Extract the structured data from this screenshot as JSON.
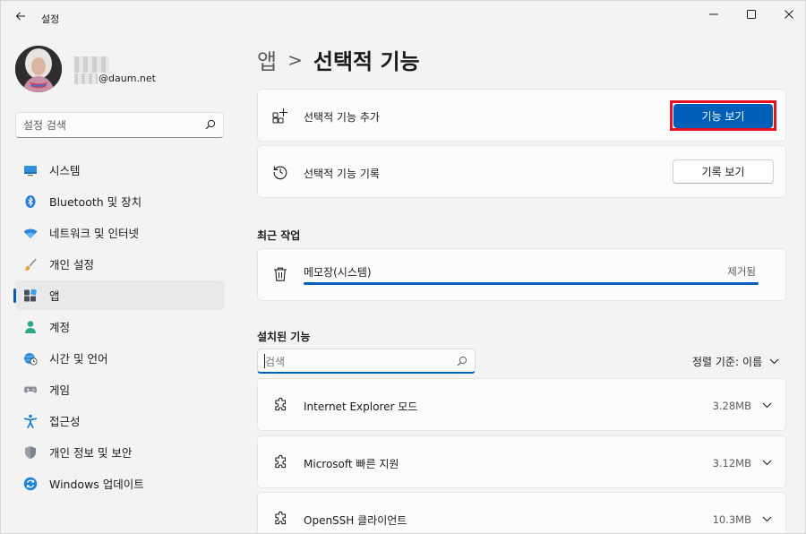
{
  "window": {
    "title": "설정"
  },
  "user": {
    "email_suffix": "@daum.net"
  },
  "sidebar": {
    "search_placeholder": "설정 검색",
    "items": [
      {
        "label": "시스템",
        "icon": "monitor-icon"
      },
      {
        "label": "Bluetooth 및 장치",
        "icon": "bluetooth-icon"
      },
      {
        "label": "네트워크 및 인터넷",
        "icon": "wifi-icon"
      },
      {
        "label": "개인 설정",
        "icon": "paintbrush-icon"
      },
      {
        "label": "앱",
        "icon": "apps-icon",
        "active": true
      },
      {
        "label": "계정",
        "icon": "person-icon"
      },
      {
        "label": "시간 및 언어",
        "icon": "globe-clock-icon"
      },
      {
        "label": "게임",
        "icon": "gamepad-icon"
      },
      {
        "label": "접근성",
        "icon": "accessibility-icon"
      },
      {
        "label": "개인 정보 및 보안",
        "icon": "shield-icon"
      },
      {
        "label": "Windows 업데이트",
        "icon": "update-icon"
      }
    ]
  },
  "breadcrumb": {
    "parent": "앱",
    "separator": ">",
    "current": "선택적 기능"
  },
  "add_feature": {
    "label": "선택적 기능 추가",
    "button": "기능 보기"
  },
  "history": {
    "label": "선택적 기능 기록",
    "button": "기록 보기"
  },
  "recent": {
    "heading": "최근 작업",
    "item": "메모장(시스템)",
    "status": "제거됨",
    "progress": 1.0
  },
  "installed": {
    "heading": "설치된 기능",
    "search_placeholder": "검색",
    "sort_label": "정렬 기준:",
    "sort_value": "이름",
    "features": [
      {
        "name": "Internet Explorer 모드",
        "size": "3.28MB"
      },
      {
        "name": "Microsoft 빠른 지원",
        "size": "3.12MB"
      },
      {
        "name": "OpenSSH 클라이언트",
        "size": "10.3MB"
      }
    ]
  },
  "colors": {
    "accent": "#005fb8",
    "highlight": "#e81123",
    "background": "#f3f3f3"
  }
}
